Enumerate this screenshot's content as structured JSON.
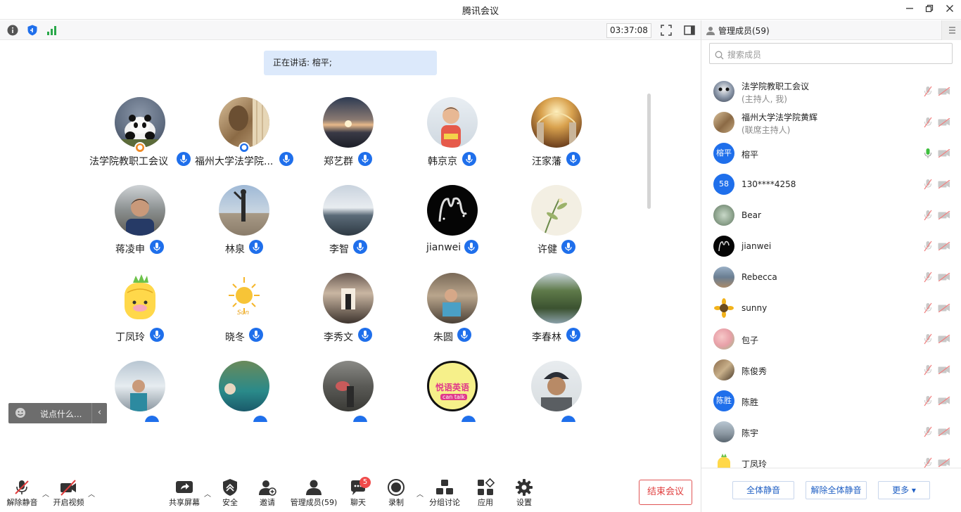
{
  "window": {
    "title": "腾讯会议",
    "minimize_icon": "minimize-icon",
    "restore_icon": "restore-icon",
    "close_icon": "close-icon"
  },
  "status": {
    "timer": "03:37:08",
    "icons": [
      "info-icon",
      "shield-icon",
      "signal-icon"
    ]
  },
  "speaking": {
    "text": "正在讲话: 榕平;"
  },
  "grid": {
    "tiles": [
      {
        "name": "法学院教职工会议",
        "role": "host"
      },
      {
        "name": "福州大学法学院...",
        "role": "cohost"
      },
      {
        "name": "郑艺群"
      },
      {
        "name": "韩京京"
      },
      {
        "name": "汪家藩"
      },
      {
        "name": "蒋凌申"
      },
      {
        "name": "林泉"
      },
      {
        "name": "李智"
      },
      {
        "name": "jianwei"
      },
      {
        "name": "许健"
      },
      {
        "name": "丁凤玲"
      },
      {
        "name": "晓冬"
      },
      {
        "name": "李秀文"
      },
      {
        "name": "朱圆"
      },
      {
        "name": "李春林"
      }
    ],
    "sun_avatar_text": "Sun",
    "english_avatar_text": "悦语英语",
    "english_avatar_sub": "can talk"
  },
  "chat": {
    "placeholder": "说点什么...",
    "collapse_icon": "chevron-left-icon"
  },
  "toolbar": {
    "unmute": "解除静音",
    "start_video": "开启视频",
    "share_screen": "共享屏幕",
    "security": "安全",
    "invite": "邀请",
    "manage_members": "管理成员(59)",
    "chat": "聊天",
    "chat_badge": "5",
    "record": "录制",
    "breakout": "分组讨论",
    "apps": "应用",
    "settings": "设置",
    "end_meeting": "结束会议"
  },
  "panel": {
    "title": "管理成员(59)",
    "search_placeholder": "搜索成员",
    "members": [
      {
        "name": "法学院教职工会议",
        "role": "(主持人, 我)",
        "mic": "muted"
      },
      {
        "name": "福州大学法学院黄辉",
        "role": "(联席主持人)",
        "mic": "muted"
      },
      {
        "name": "榕平",
        "initials": "榕平",
        "mic": "active"
      },
      {
        "name": "130****4258",
        "initials": "58",
        "mic": "muted"
      },
      {
        "name": "Bear",
        "mic": "muted"
      },
      {
        "name": "jianwei",
        "mic": "muted"
      },
      {
        "name": "Rebecca",
        "mic": "muted"
      },
      {
        "name": "sunny",
        "mic": "muted"
      },
      {
        "name": "包子",
        "mic": "muted"
      },
      {
        "name": "陈俊秀",
        "mic": "muted"
      },
      {
        "name": "陈胜",
        "initials": "陈胜",
        "mic": "muted"
      },
      {
        "name": "陈宇",
        "mic": "muted"
      },
      {
        "name": "丁凤玲",
        "mic": "muted"
      }
    ],
    "mute_all": "全体静音",
    "unmute_all": "解除全体静音",
    "more": "更多 ▾"
  },
  "colors": {
    "accent": "#1f6feb",
    "end_red": "#e03e3e",
    "speaker_bg": "#dce9fb",
    "mic_active": "#3fbf3f"
  }
}
